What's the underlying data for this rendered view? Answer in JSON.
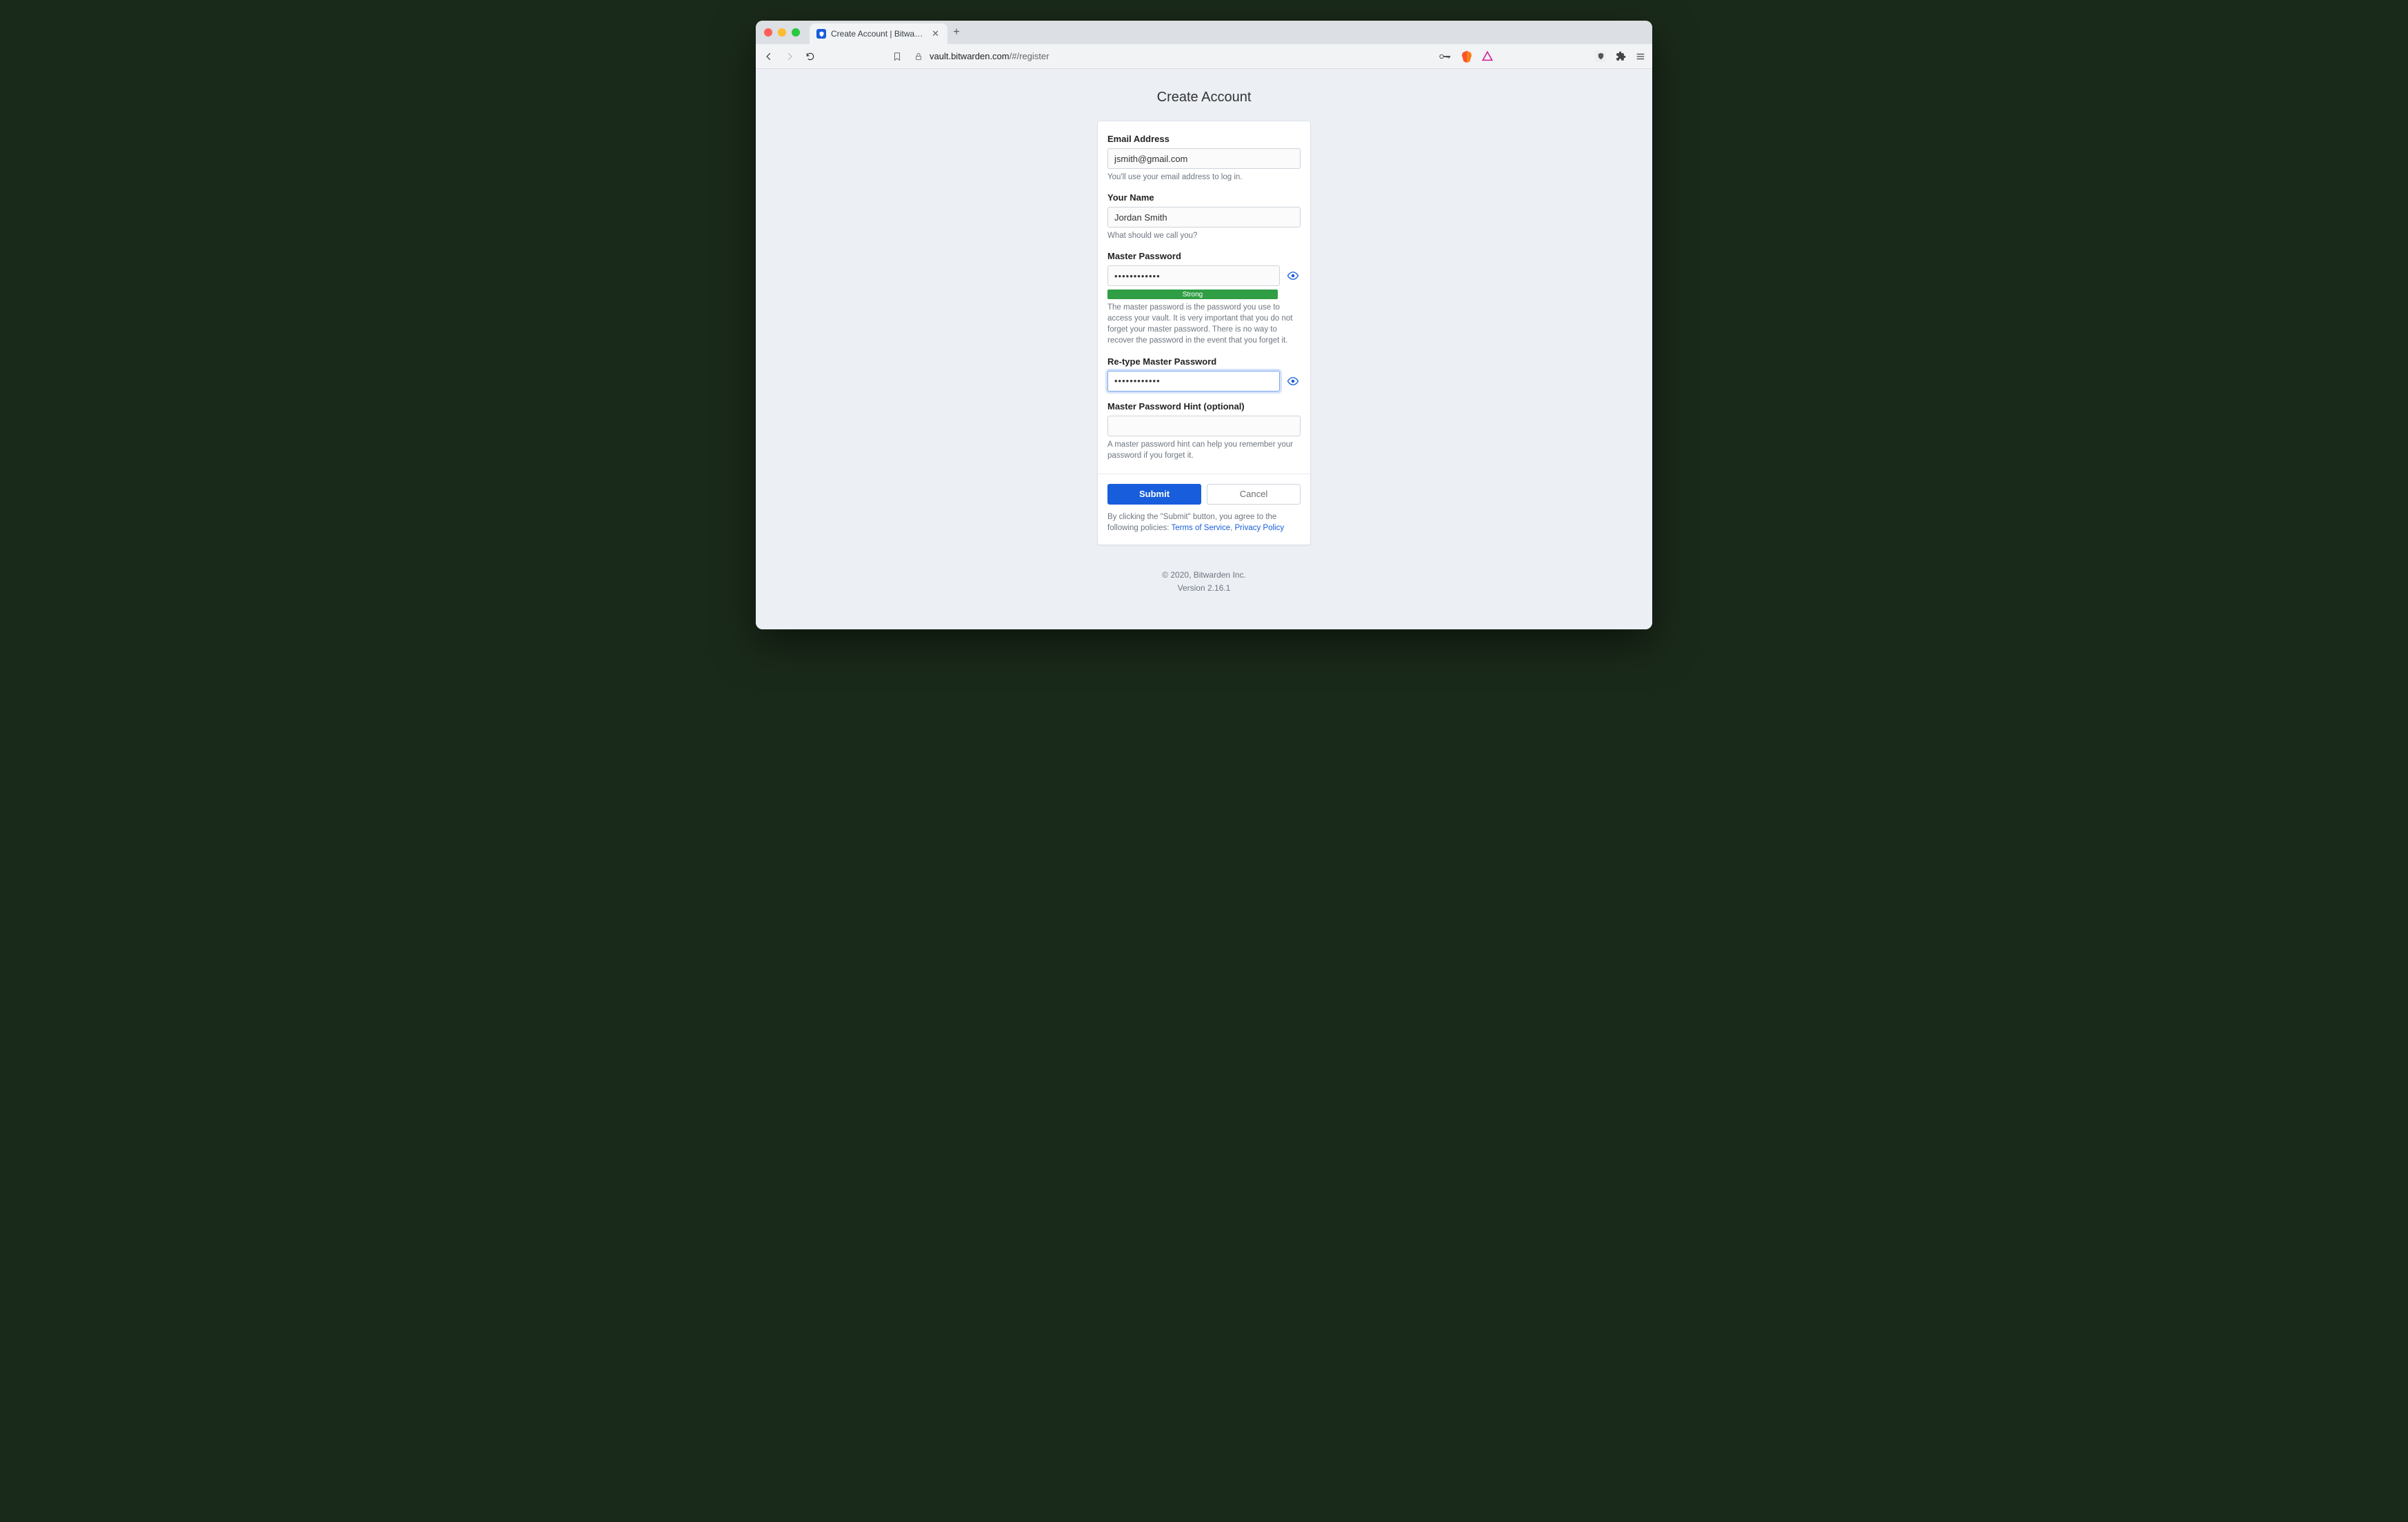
{
  "browser": {
    "tab_title": "Create Account | Bitwarden Web",
    "url_host": "vault.bitwarden.com",
    "url_path": "/#/register"
  },
  "page": {
    "title": "Create Account"
  },
  "form": {
    "email": {
      "label": "Email Address",
      "value": "jsmith@gmail.com",
      "hint": "You'll use your email address to log in."
    },
    "name": {
      "label": "Your Name",
      "value": "Jordan Smith",
      "hint": "What should we call you?"
    },
    "master_password": {
      "label": "Master Password",
      "value": "••••••••••••",
      "strength": "Strong",
      "hint": "The master password is the password you use to access your vault. It is very important that you do not forget your master password. There is no way to recover the password in the event that you forget it."
    },
    "retype": {
      "label": "Re-type Master Password",
      "value": "••••••••••••"
    },
    "hint_field": {
      "label": "Master Password Hint (optional)",
      "value": "",
      "hint": "A master password hint can help you remember your password if you forget it."
    },
    "submit_label": "Submit",
    "cancel_label": "Cancel",
    "agree_prefix": "By clicking the \"Submit\" button, you agree to the following policies: ",
    "tos_label": "Terms of Service",
    "sep": ", ",
    "privacy_label": "Privacy Policy"
  },
  "footer": {
    "copyright": "© 2020, Bitwarden Inc.",
    "version": "Version 2.16.1"
  }
}
